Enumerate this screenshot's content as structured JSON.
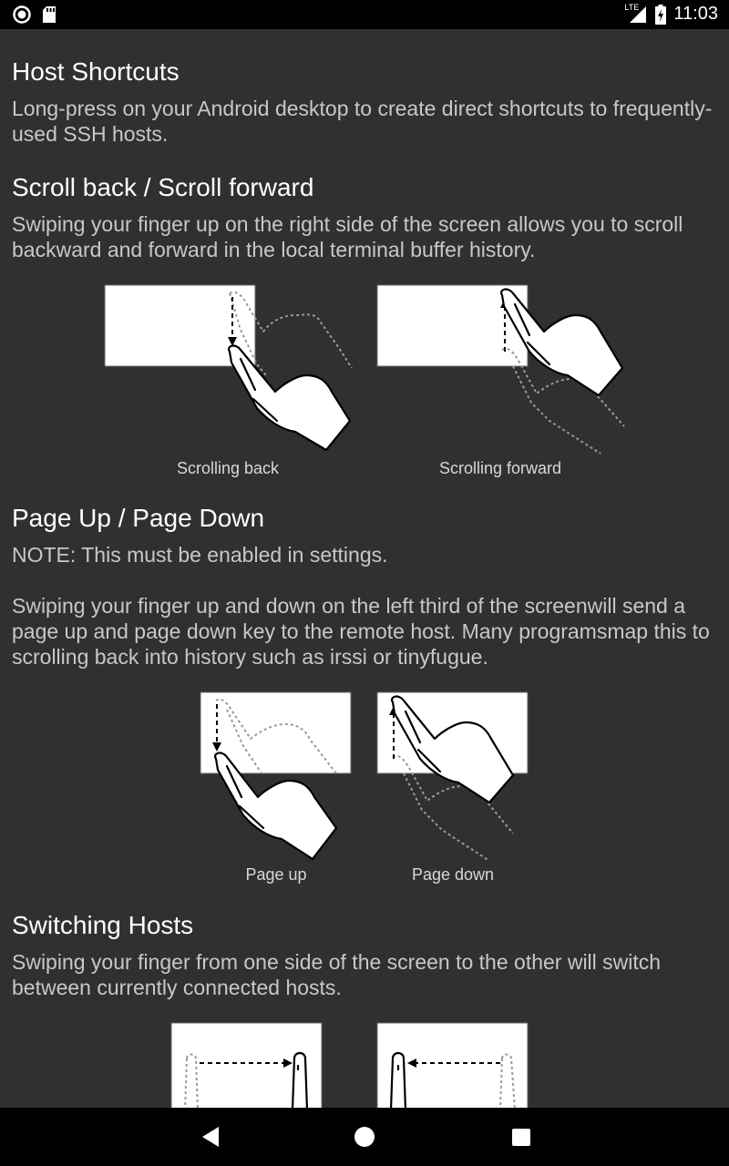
{
  "status_bar": {
    "time": "11:03",
    "network": "LTE",
    "icons": [
      "circle-notification-icon",
      "sd-card-icon",
      "lte-signal-icon",
      "battery-charging-icon"
    ]
  },
  "sections": [
    {
      "title": "Host Shortcuts",
      "body": "Long-press on your Android desktop to create direct shortcuts to frequently-used SSH hosts."
    },
    {
      "title": "Scroll back / Scroll forward",
      "body": "Swiping your finger up on the right side of the screen allows you to scroll backward and forward in the local terminal buffer history.",
      "figures": [
        "Scrolling back",
        "Scrolling forward"
      ]
    },
    {
      "title": "Page Up / Page Down",
      "note": "NOTE: This must be enabled in settings.",
      "body": "Swiping your finger up and down on the left third of the screenwill send a page up and page down key to the remote host. Many programsmap this to scrolling back into history such as irssi or tinyfugue.",
      "figures": [
        "Page up",
        "Page down"
      ]
    },
    {
      "title": "Switching Hosts",
      "body": "Swiping your finger from one side of the screen to the other will switch between currently connected hosts."
    }
  ],
  "nav_bar": {
    "icons": [
      "back-icon",
      "home-icon",
      "recents-icon"
    ]
  }
}
